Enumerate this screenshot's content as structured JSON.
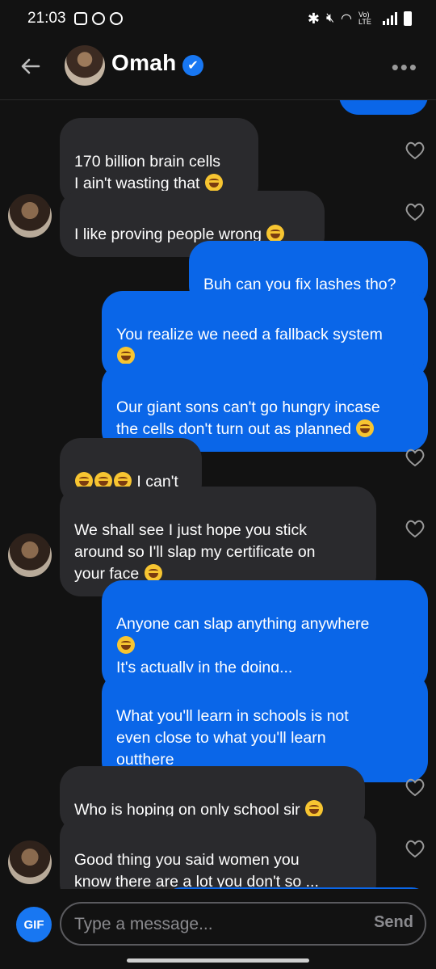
{
  "status_bar": {
    "time": "21:03",
    "network": "Vo) LTE"
  },
  "header": {
    "contact_name": "Omah",
    "verified_mark": "✔",
    "more_label": "•••",
    "back_icon": "arrow-left-icon"
  },
  "messages": [
    {
      "dir": "in",
      "text": "170 billion brain cells\nI ain't wasting that  ",
      "emojis": 1
    },
    {
      "dir": "in",
      "text": "I like proving people wrong ",
      "emojis": 1
    },
    {
      "dir": "out",
      "text": "Buh can you fix lashes tho?",
      "emojis": 0
    },
    {
      "dir": "out",
      "text": "You realize we need a fallback system\n",
      "emojis": 1
    },
    {
      "dir": "out",
      "text": "Our giant sons can't go hungry incase\nthe cells don't turn out as planned ",
      "emojis": 1
    },
    {
      "dir": "in",
      "text": " I can't",
      "emojis_prefix": 3
    },
    {
      "dir": "in",
      "text": "We shall see I just hope you stick\naround so I'll slap my certificate on\nyour face ",
      "emojis": 1
    },
    {
      "dir": "out",
      "text": "Anyone can slap anything anywhere\n",
      "text2": "\nIt's actually in the doing...",
      "emojis": 1
    },
    {
      "dir": "out",
      "text": "What you'll learn in schools is not\neven close to what you'll learn\noutthere",
      "emojis": 0
    },
    {
      "dir": "in",
      "text": "Who is hoping on only school sir ",
      "emojis": 1
    },
    {
      "dir": "in",
      "text": "Good thing you said women you\nknow  there are a lot you don't so ...",
      "emojis": 0
    }
  ],
  "composer": {
    "gif_label": "GIF",
    "placeholder": "Type a message...",
    "send_label": "Send"
  },
  "colors": {
    "outgoing": "#0a66e8",
    "incoming": "#2a2a2d",
    "background": "#121212",
    "verified": "#1877f2"
  }
}
